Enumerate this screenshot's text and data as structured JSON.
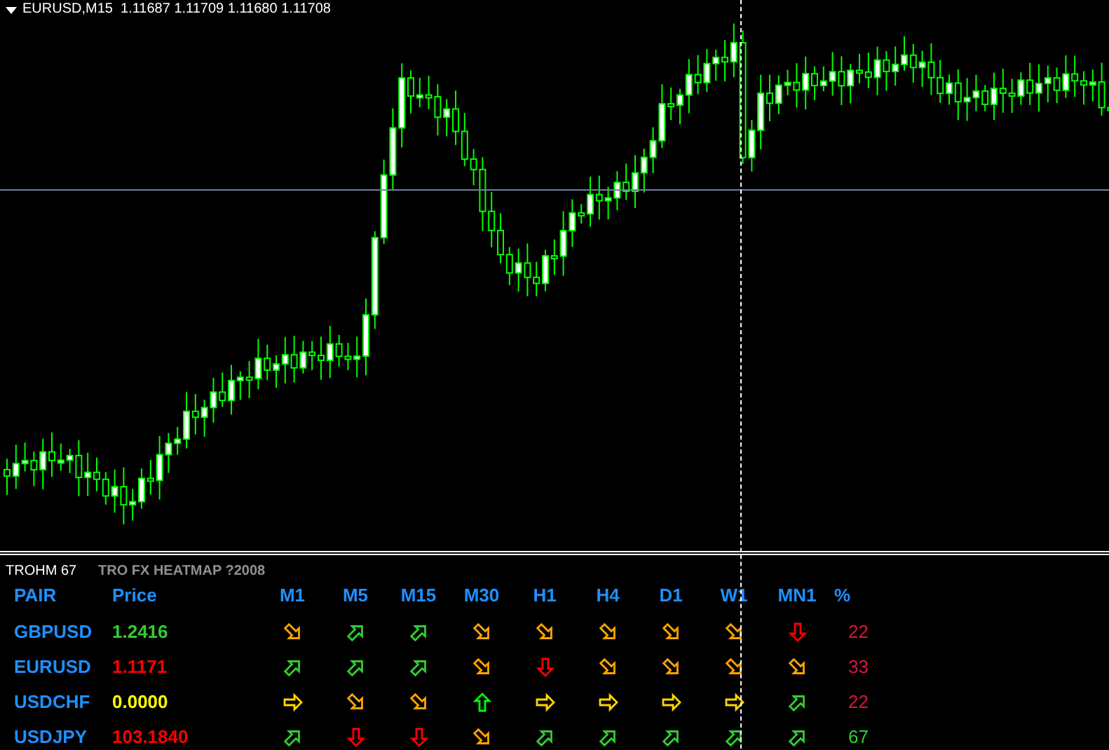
{
  "chart": {
    "header": "EURUSD,M15  1.11687 1.11709 1.11680 1.11708"
  },
  "indicator": {
    "short_name": "TROHM 67",
    "title": "TRO FX HEATMAP ?2008"
  },
  "heatmap": {
    "columns": [
      "PAIR",
      "Price",
      "M1",
      "M5",
      "M15",
      "M30",
      "H1",
      "H4",
      "D1",
      "W1",
      "MN1",
      "%"
    ],
    "rows": [
      {
        "pair": "GBPUSD",
        "price": {
          "text": "1.2416",
          "color": "#32cd32"
        },
        "arrows": [
          {
            "kind": "down-right"
          },
          {
            "kind": "up-right"
          },
          {
            "kind": "up-right"
          },
          {
            "kind": "down-right"
          },
          {
            "kind": "down-right"
          },
          {
            "kind": "down-right"
          },
          {
            "kind": "down-right"
          },
          {
            "kind": "down-right"
          },
          {
            "kind": "down"
          }
        ],
        "percent": {
          "text": "22",
          "color": "#dc143c"
        }
      },
      {
        "pair": "EURUSD",
        "price": {
          "text": "1.1171",
          "color": "#ff0000"
        },
        "arrows": [
          {
            "kind": "up-right"
          },
          {
            "kind": "up-right"
          },
          {
            "kind": "up-right"
          },
          {
            "kind": "down-right"
          },
          {
            "kind": "down"
          },
          {
            "kind": "down-right"
          },
          {
            "kind": "down-right"
          },
          {
            "kind": "down-right"
          },
          {
            "kind": "down-right"
          }
        ],
        "percent": {
          "text": "33",
          "color": "#dc143c"
        }
      },
      {
        "pair": "USDCHF",
        "price": {
          "text": "0.0000",
          "color": "#ffff00"
        },
        "arrows": [
          {
            "kind": "right"
          },
          {
            "kind": "down-right"
          },
          {
            "kind": "down-right"
          },
          {
            "kind": "up"
          },
          {
            "kind": "right"
          },
          {
            "kind": "right"
          },
          {
            "kind": "right"
          },
          {
            "kind": "right"
          },
          {
            "kind": "up-right"
          }
        ],
        "percent": {
          "text": "22",
          "color": "#dc143c"
        }
      },
      {
        "pair": "USDJPY",
        "price": {
          "text": "103.1840",
          "color": "#ff0000"
        },
        "arrows": [
          {
            "kind": "up-right"
          },
          {
            "kind": "down"
          },
          {
            "kind": "down"
          },
          {
            "kind": "down-right"
          },
          {
            "kind": "up-right"
          },
          {
            "kind": "up-right"
          },
          {
            "kind": "up-right"
          },
          {
            "kind": "up-right"
          },
          {
            "kind": "up-right"
          }
        ],
        "percent": {
          "text": "67",
          "color": "#32cd32"
        }
      }
    ]
  }
}
